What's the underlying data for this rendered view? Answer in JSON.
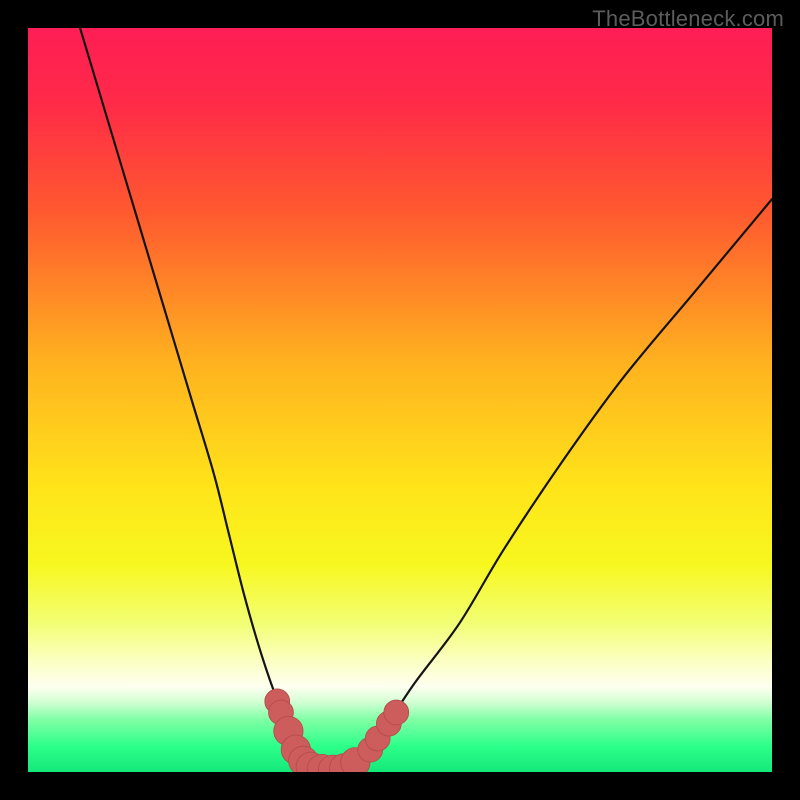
{
  "watermark": "TheBottleneck.com",
  "colors": {
    "frame": "#000000",
    "gradient_stops": [
      {
        "offset": 0.0,
        "color": "#ff1e55"
      },
      {
        "offset": 0.1,
        "color": "#ff2a48"
      },
      {
        "offset": 0.25,
        "color": "#ff5a2f"
      },
      {
        "offset": 0.45,
        "color": "#ffb21f"
      },
      {
        "offset": 0.62,
        "color": "#ffe51a"
      },
      {
        "offset": 0.72,
        "color": "#f7f71f"
      },
      {
        "offset": 0.8,
        "color": "#f2ff74"
      },
      {
        "offset": 0.85,
        "color": "#fbffc1"
      },
      {
        "offset": 0.885,
        "color": "#fefff0"
      },
      {
        "offset": 0.905,
        "color": "#d5ffd5"
      },
      {
        "offset": 0.93,
        "color": "#7fffa5"
      },
      {
        "offset": 0.965,
        "color": "#2dff8a"
      },
      {
        "offset": 1.0,
        "color": "#14e87a"
      }
    ],
    "curve": "#141414",
    "marker_fill": "#cd5c5c",
    "marker_stroke": "#b24a4a"
  },
  "chart_data": {
    "type": "line",
    "title": "",
    "xlabel": "",
    "ylabel": "",
    "xlim": [
      0,
      100
    ],
    "ylim": [
      0,
      100
    ],
    "series": [
      {
        "name": "bottleneck-curve",
        "x": [
          7,
          10,
          13,
          16,
          19,
          22,
          25,
          27,
          29,
          31,
          33,
          35,
          36,
          38,
          41,
          43,
          45,
          48,
          52,
          58,
          64,
          72,
          80,
          90,
          100
        ],
        "y": [
          100,
          90,
          80,
          70,
          60,
          50,
          40,
          32,
          24,
          17,
          11,
          6,
          3,
          1,
          0,
          0,
          2,
          6,
          12,
          20,
          30,
          42,
          53,
          65,
          77
        ]
      }
    ],
    "markers": [
      {
        "x": 33.5,
        "y": 9.5,
        "r": 1.0
      },
      {
        "x": 34.0,
        "y": 8.0,
        "r": 1.0
      },
      {
        "x": 35.0,
        "y": 5.5,
        "r": 1.3
      },
      {
        "x": 36.0,
        "y": 3.0,
        "r": 1.3
      },
      {
        "x": 37.0,
        "y": 1.5,
        "r": 1.3
      },
      {
        "x": 38.0,
        "y": 0.7,
        "r": 1.3
      },
      {
        "x": 39.5,
        "y": 0.4,
        "r": 1.3
      },
      {
        "x": 41.0,
        "y": 0.3,
        "r": 1.3
      },
      {
        "x": 42.5,
        "y": 0.5,
        "r": 1.3
      },
      {
        "x": 44.0,
        "y": 1.3,
        "r": 1.3
      },
      {
        "x": 46.0,
        "y": 3.0,
        "r": 1.0
      },
      {
        "x": 47.0,
        "y": 4.5,
        "r": 1.0
      },
      {
        "x": 48.5,
        "y": 6.5,
        "r": 1.0
      },
      {
        "x": 49.5,
        "y": 8.0,
        "r": 1.0
      }
    ]
  }
}
